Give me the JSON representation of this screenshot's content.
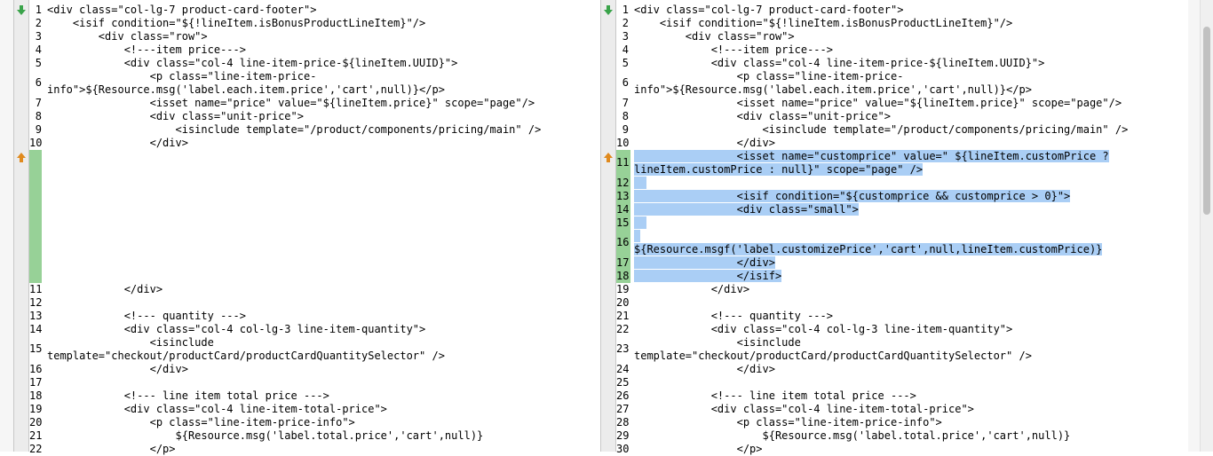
{
  "left_pane": {
    "rows_top": [
      {
        "num": "1",
        "text": "<div class=\"col-lg-7 product-card-footer\">"
      },
      {
        "num": "2",
        "text": "    <isif condition=\"${!lineItem.isBonusProductLineItem}\"/>"
      },
      {
        "num": "3",
        "text": "        <div class=\"row\">"
      },
      {
        "num": "4",
        "text": "            <!---item price--->"
      },
      {
        "num": "5",
        "text": "            <div class=\"col-4 line-item-price-${lineItem.UUID}\">"
      },
      {
        "num": "6",
        "text": "                <p class=\"line-item-price-\ninfo\">${Resource.msg('label.each.item.price','cart',null)}</p>"
      },
      {
        "num": "7",
        "text": "                <isset name=\"price\" value=\"${lineItem.price}\" scope=\"page\"/>"
      },
      {
        "num": "8",
        "text": "                <div class=\"unit-price\">"
      },
      {
        "num": "9",
        "text": "                    <isinclude template=\"/product/components/pricing/main\" />"
      },
      {
        "num": "10",
        "text": "                </div>"
      }
    ],
    "rows_bottom": [
      {
        "num": "11",
        "text": "            </div>"
      },
      {
        "num": "12",
        "text": ""
      },
      {
        "num": "13",
        "text": "            <!--- quantity --->"
      },
      {
        "num": "14",
        "text": "            <div class=\"col-4 col-lg-3 line-item-quantity\">"
      },
      {
        "num": "15",
        "text": "                <isinclude\ntemplate=\"checkout/productCard/productCardQuantitySelector\" />"
      },
      {
        "num": "16",
        "text": "                </div>"
      },
      {
        "num": "17",
        "text": ""
      },
      {
        "num": "18",
        "text": "            <!--- line item total price --->"
      },
      {
        "num": "19",
        "text": "            <div class=\"col-4 line-item-total-price\">"
      },
      {
        "num": "20",
        "text": "                <p class=\"line-item-price-info\">"
      },
      {
        "num": "21",
        "text": "                    ${Resource.msg('label.total.price','cart',null)}"
      },
      {
        "num": "22",
        "text": "                </p>"
      }
    ]
  },
  "right_pane": {
    "rows_top": [
      {
        "num": "1",
        "text": "<div class=\"col-lg-7 product-card-footer\">"
      },
      {
        "num": "2",
        "text": "    <isif condition=\"${!lineItem.isBonusProductLineItem}\"/>"
      },
      {
        "num": "3",
        "text": "        <div class=\"row\">"
      },
      {
        "num": "4",
        "text": "            <!---item price--->"
      },
      {
        "num": "5",
        "text": "            <div class=\"col-4 line-item-price-${lineItem.UUID}\">"
      },
      {
        "num": "6",
        "text": "                <p class=\"line-item-price-\ninfo\">${Resource.msg('label.each.item.price','cart',null)}</p>"
      },
      {
        "num": "7",
        "text": "                <isset name=\"price\" value=\"${lineItem.price}\" scope=\"page\"/>"
      },
      {
        "num": "8",
        "text": "                <div class=\"unit-price\">"
      },
      {
        "num": "9",
        "text": "                    <isinclude template=\"/product/components/pricing/main\" />"
      },
      {
        "num": "10",
        "text": "                </div>"
      }
    ],
    "rows_added": [
      {
        "num": "11",
        "text": "                <isset name=\"customprice\" value=\" ${lineItem.customPrice ?\nlineItem.customPrice : null}\" scope=\"page\" />"
      },
      {
        "num": "12",
        "text": ""
      },
      {
        "num": "13",
        "text": "                <isif condition=\"${customprice && customprice > 0}\">"
      },
      {
        "num": "14",
        "text": "                <div class=\"small\">"
      },
      {
        "num": "15",
        "text": ""
      },
      {
        "num": "16",
        "text": "\n${Resource.msgf('label.customizePrice','cart',null,lineItem.customPrice)}"
      },
      {
        "num": "17",
        "text": "                </div>"
      },
      {
        "num": "18",
        "text": "                </isif>"
      }
    ],
    "rows_bottom": [
      {
        "num": "19",
        "text": "            </div>"
      },
      {
        "num": "20",
        "text": ""
      },
      {
        "num": "21",
        "text": "            <!--- quantity --->"
      },
      {
        "num": "22",
        "text": "            <div class=\"col-4 col-lg-3 line-item-quantity\">"
      },
      {
        "num": "23",
        "text": "                <isinclude\ntemplate=\"checkout/productCard/productCardQuantitySelector\" />"
      },
      {
        "num": "24",
        "text": "                </div>"
      },
      {
        "num": "25",
        "text": ""
      },
      {
        "num": "26",
        "text": "            <!--- line item total price --->"
      },
      {
        "num": "27",
        "text": "            <div class=\"col-4 line-item-total-price\">"
      },
      {
        "num": "28",
        "text": "                <p class=\"line-item-price-info\">"
      },
      {
        "num": "29",
        "text": "                    ${Resource.msg('label.total.price','cart',null)}"
      },
      {
        "num": "30",
        "text": "                </p>"
      }
    ]
  },
  "colors": {
    "gap_green": "#97d197",
    "selection_blue": "#aacef5",
    "next_arrow": "#3aa34a",
    "change_arrow": "#e08a1e"
  },
  "icons": {
    "next_diff": "green-down-arrow-icon",
    "change_marker": "orange-up-arrow-icon"
  }
}
